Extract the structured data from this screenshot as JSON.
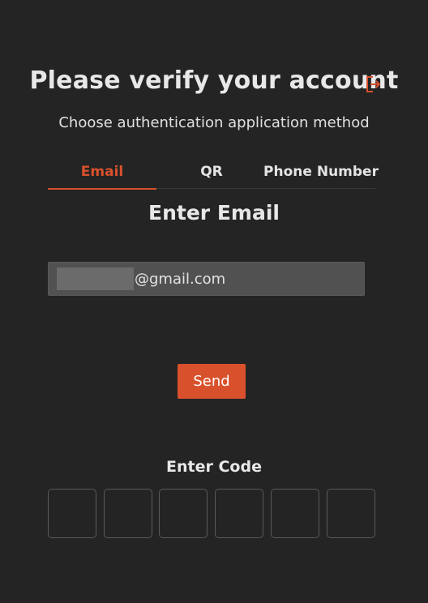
{
  "header": {
    "title": "Please verify your account",
    "logout_icon": "logout-icon",
    "subtitle": "Choose authentication application method"
  },
  "tabs": [
    {
      "label": "Email",
      "active": true
    },
    {
      "label": "QR",
      "active": false
    },
    {
      "label": "Phone Number",
      "active": false
    }
  ],
  "email_section": {
    "heading": "Enter Email",
    "email_value_visible": "@gmail.com",
    "send_label": "Send"
  },
  "code_section": {
    "heading": "Enter Code",
    "code_digits": [
      "",
      "",
      "",
      "",
      "",
      ""
    ]
  },
  "colors": {
    "background": "#242424",
    "accent": "#d9512c",
    "input_bg": "#515151",
    "text": "#e6e6e6"
  }
}
